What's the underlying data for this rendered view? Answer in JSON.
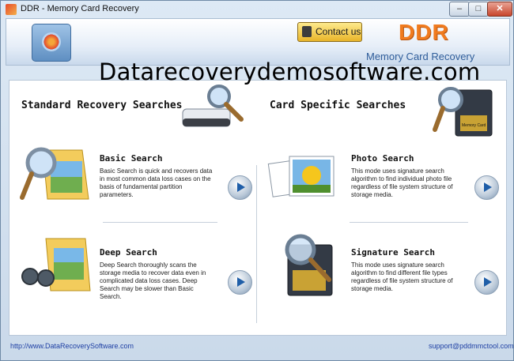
{
  "window": {
    "title": "DDR - Memory Card Recovery",
    "minimize": "–",
    "maximize": "□",
    "close": "✕"
  },
  "header": {
    "contact_label": "Contact us",
    "brand": "DDR",
    "subtitle": "Memory Card Recovery",
    "watermark": "Datarecoverydemosoftware.com"
  },
  "sections": {
    "standard_heading": "Standard Recovery Searches",
    "card_heading": "Card Specific Searches"
  },
  "cards": [
    {
      "title": "Basic Search",
      "description": "Basic Search is quick and recovers data in most common data loss cases on the basis of fundamental partition parameters."
    },
    {
      "title": "Deep Search",
      "description": "Deep Search thoroughly scans the storage media to recover data even in complicated data loss cases. Deep Search may be slower than Basic Search."
    },
    {
      "title": "Photo Search",
      "description": "This mode uses signature search algorithm to find individual photo file regardless of file system structure of storage media."
    },
    {
      "title": "Signature Search",
      "description": "This mode uses signature search algorithm to find different file types regardless of file system structure of storage media."
    }
  ],
  "illustrations": {
    "memory_card_label": "Memory Card"
  },
  "footer": {
    "website": "http://www.DataRecoverySoftware.com",
    "email": "support@pddmmctool.com"
  },
  "colors": {
    "brand": "#f07b1f",
    "link": "#1d3fa3",
    "accent": "#1f5ea8"
  }
}
